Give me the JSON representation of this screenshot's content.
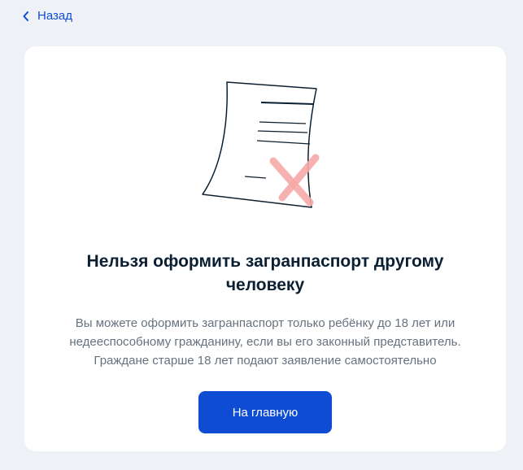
{
  "nav": {
    "back_label": "Назад"
  },
  "card": {
    "illustration": "rejected-document-icon",
    "title": "Нельзя оформить загранпаспорт другому человеку",
    "description": [
      "Вы можете оформить загранпаспорт только ребёнку до 18 лет или",
      "недееспособному гражданину, если вы его законный представитель.",
      "Граждане старше 18 лет подают заявление самостоятельно"
    ],
    "button_label": "На главную"
  },
  "colors": {
    "accent": "#0d4cd3",
    "page_background": "#eef2f6",
    "title_text": "#0b1f33",
    "body_text": "#66727f",
    "cross": "#f7a9a9"
  }
}
